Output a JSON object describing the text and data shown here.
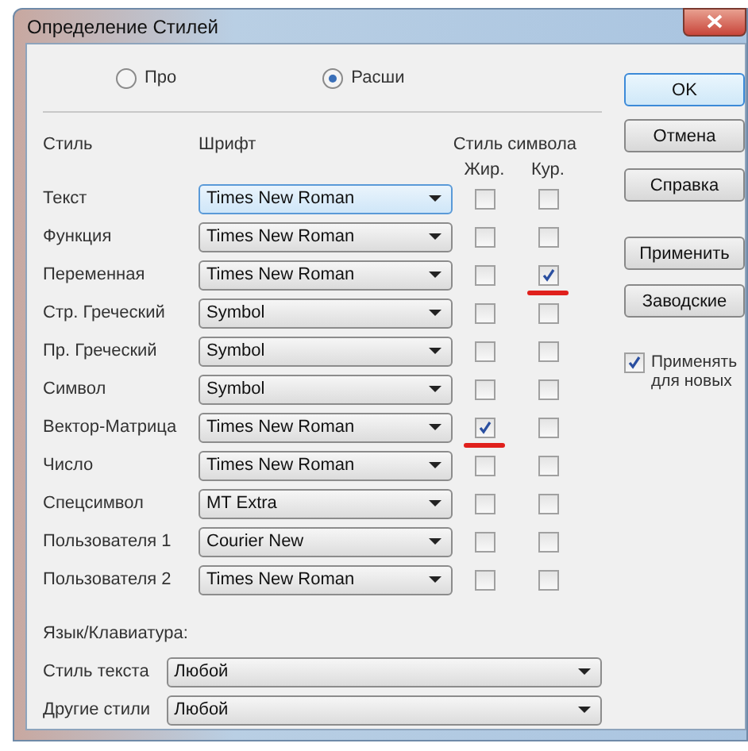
{
  "window": {
    "title": "Определение Стилей"
  },
  "mode_options": [
    {
      "label": "Про",
      "selected": false
    },
    {
      "label": "Расши",
      "selected": true
    }
  ],
  "headers": {
    "style": "Стиль",
    "font": "Шрифт",
    "char_style": "Стиль символа",
    "bold": "Жир.",
    "italic": "Кур."
  },
  "styles": [
    {
      "name": "Текст",
      "font": "Times New Roman",
      "bold": {
        "checked": false,
        "underlined": false
      },
      "italic": {
        "checked": false,
        "underlined": false
      },
      "focused": true
    },
    {
      "name": "Функция",
      "font": "Times New Roman",
      "bold": {
        "checked": false,
        "underlined": false
      },
      "italic": {
        "checked": false,
        "underlined": false
      },
      "focused": false
    },
    {
      "name": "Переменная",
      "font": "Times New Roman",
      "bold": {
        "checked": false,
        "underlined": false
      },
      "italic": {
        "checked": true,
        "underlined": true
      },
      "focused": false
    },
    {
      "name": "Стр. Греческий",
      "font": "Symbol",
      "bold": {
        "checked": false,
        "underlined": false
      },
      "italic": {
        "checked": false,
        "underlined": false
      },
      "focused": false
    },
    {
      "name": "Пр. Греческий",
      "font": "Symbol",
      "bold": {
        "checked": false,
        "underlined": false
      },
      "italic": {
        "checked": false,
        "underlined": false
      },
      "focused": false
    },
    {
      "name": "Символ",
      "font": "Symbol",
      "bold": {
        "checked": false,
        "underlined": false
      },
      "italic": {
        "checked": false,
        "underlined": false
      },
      "focused": false
    },
    {
      "name": "Вектор-Матрица",
      "font": "Times New Roman",
      "bold": {
        "checked": true,
        "underlined": true
      },
      "italic": {
        "checked": false,
        "underlined": false
      },
      "focused": false
    },
    {
      "name": "Число",
      "font": "Times New Roman",
      "bold": {
        "checked": false,
        "underlined": false
      },
      "italic": {
        "checked": false,
        "underlined": false
      },
      "focused": false
    },
    {
      "name": "Спецсимвол",
      "font": "MT Extra",
      "bold": {
        "checked": false,
        "underlined": false
      },
      "italic": {
        "checked": false,
        "underlined": false
      },
      "focused": false
    },
    {
      "name": "Пользователя 1",
      "font": "Courier New",
      "bold": {
        "checked": false,
        "underlined": false
      },
      "italic": {
        "checked": false,
        "underlined": false
      },
      "focused": false
    },
    {
      "name": "Пользователя 2",
      "font": "Times New Roman",
      "bold": {
        "checked": false,
        "underlined": false
      },
      "italic": {
        "checked": false,
        "underlined": false
      },
      "focused": false
    }
  ],
  "language": {
    "title": "Язык/Клавиатура:",
    "fields": [
      {
        "label": "Стиль текста",
        "value": "Любой"
      },
      {
        "label": "Другие стили",
        "value": "Любой"
      }
    ]
  },
  "buttons": [
    {
      "label": "OK",
      "default": true
    },
    {
      "label": "Отмена",
      "default": false
    },
    {
      "label": "Справка",
      "default": false
    },
    {
      "label": "Применить",
      "default": false
    },
    {
      "label": "Заводские",
      "default": false
    }
  ],
  "apply_new": {
    "label": "Применять для новых",
    "checked": true
  }
}
